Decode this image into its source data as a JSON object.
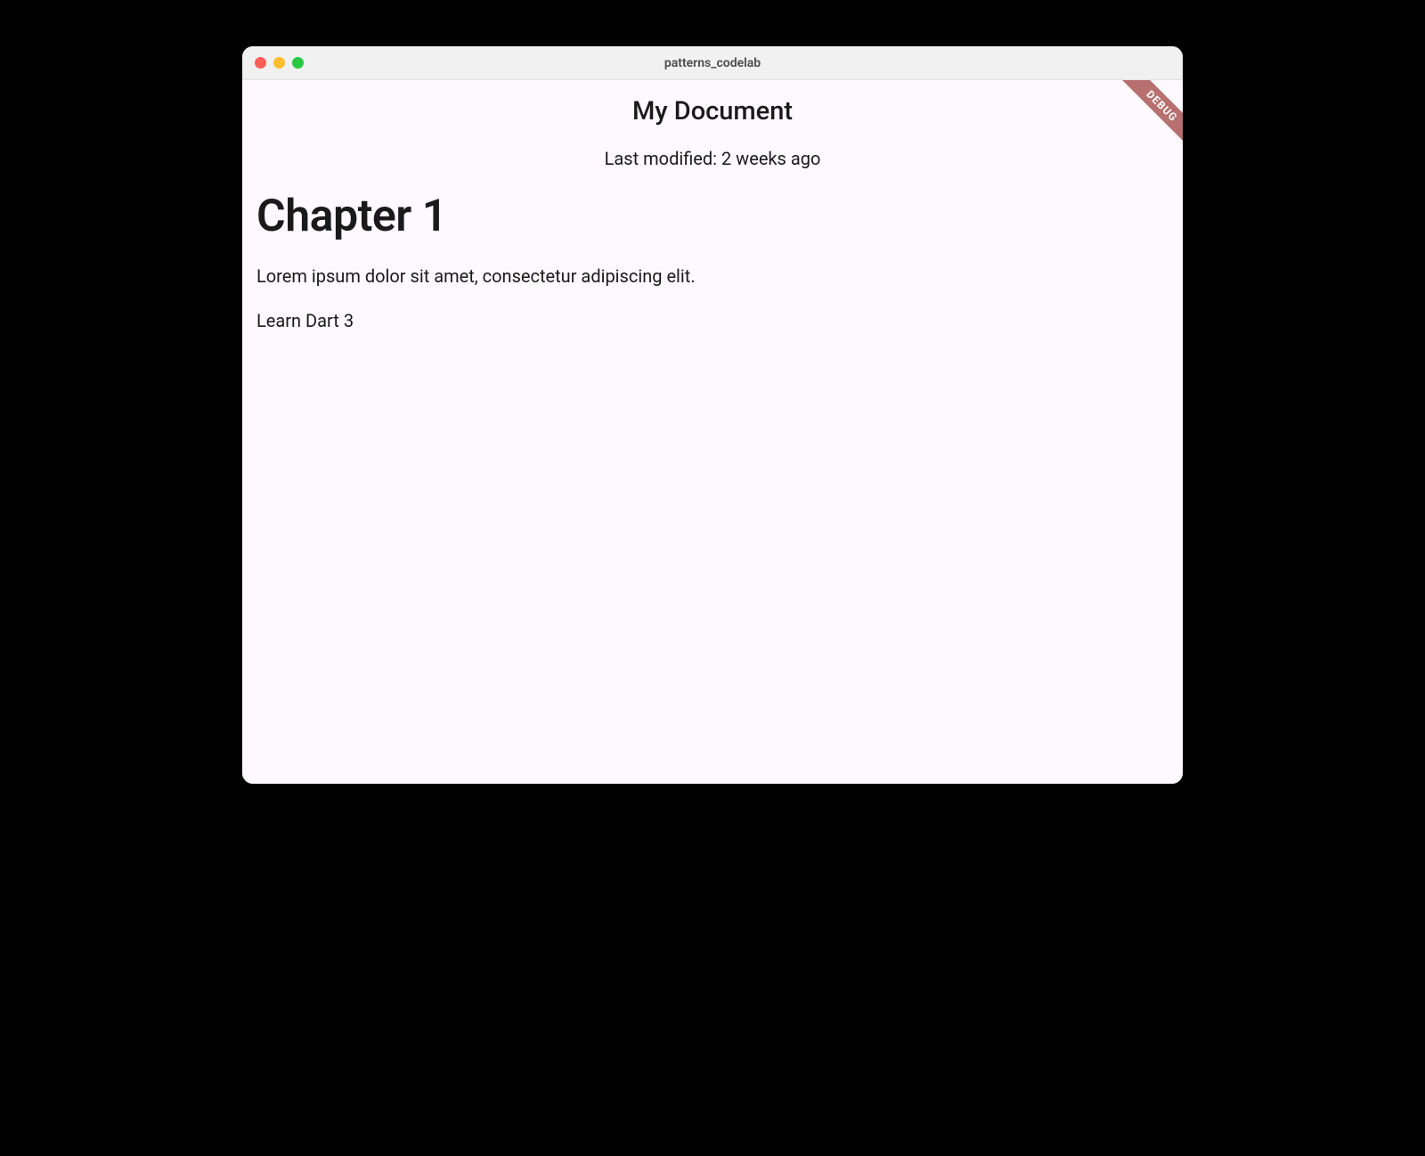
{
  "window": {
    "title": "patterns_codelab"
  },
  "debug_banner": "DEBUG",
  "app": {
    "title": "My Document",
    "last_modified": "Last modified: 2 weeks ago"
  },
  "document": {
    "heading": "Chapter 1",
    "paragraph": "Lorem ipsum dolor sit amet, consectetur adipiscing elit.",
    "extra_line": "Learn Dart 3"
  }
}
